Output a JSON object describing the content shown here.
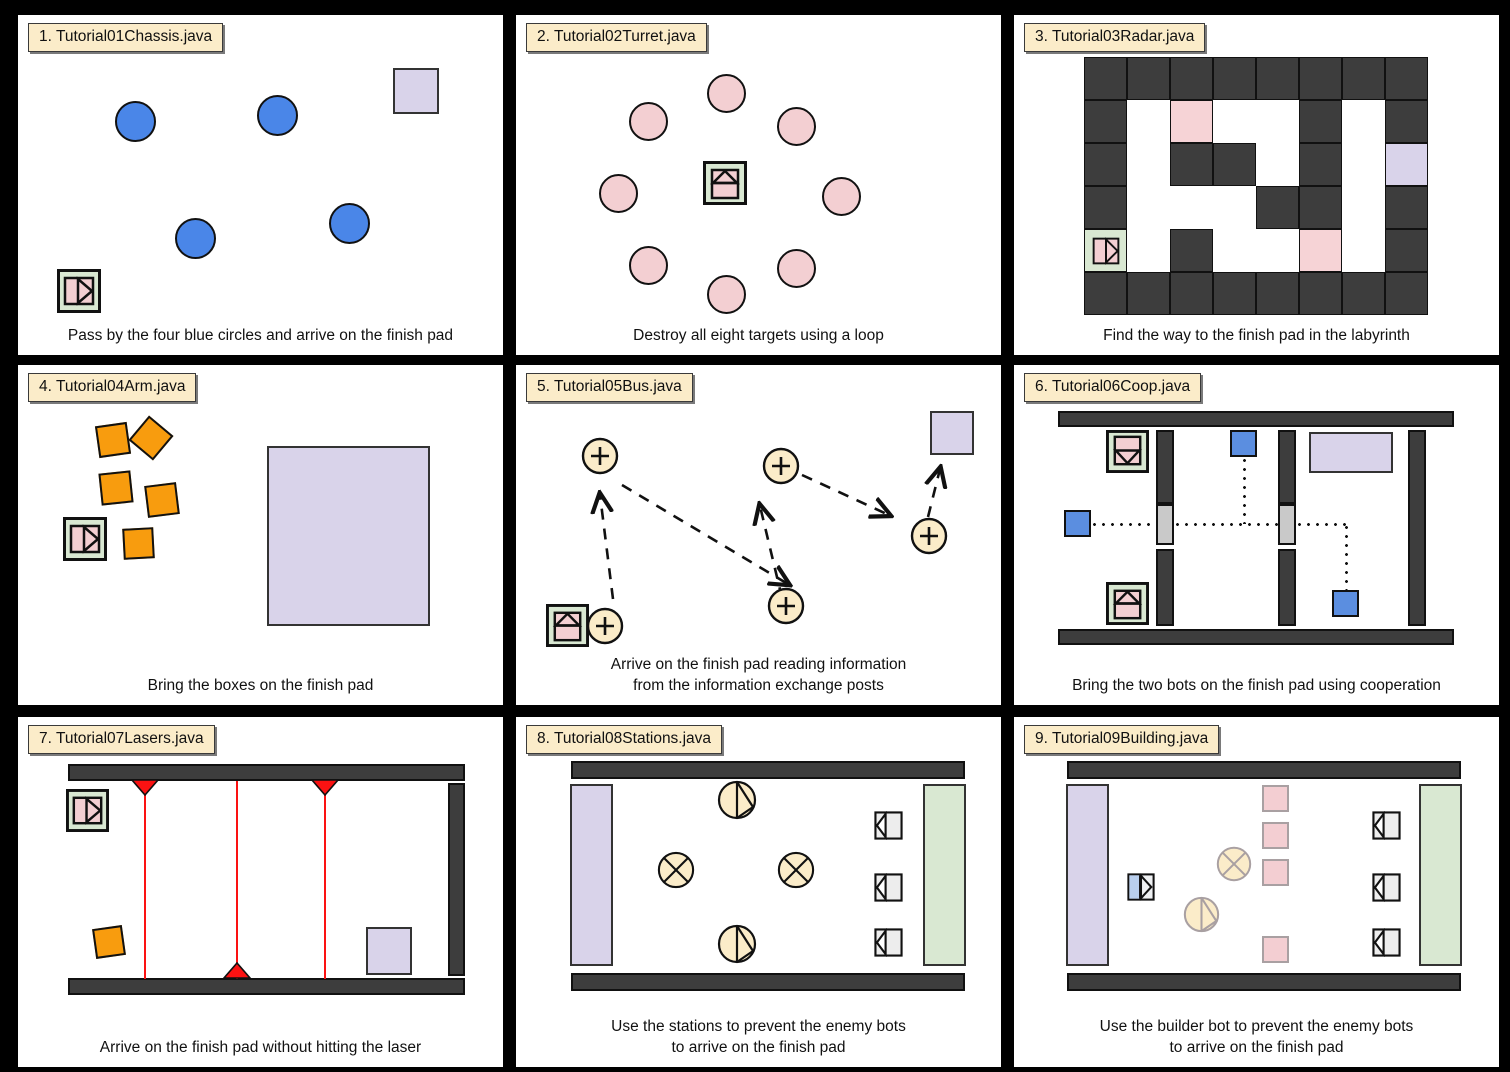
{
  "meta": {
    "background_color": "#000000",
    "panel_background": "#ffffff",
    "title_background": "#fbecc9",
    "accent_blue": "#4a86e8",
    "accent_pink": "#f3cfd2",
    "accent_purple": "#d9d3ea",
    "accent_green": "#d9e8d2",
    "accent_orange": "#f89c0e",
    "wall_gray": "#3d3d3d",
    "laser_red": "#fb1212",
    "post_cream": "#fbecc9"
  },
  "panels": [
    {
      "index": "1.",
      "title": "1. Tutorial01Chassis.java",
      "caption": "Pass by the four blue circles and arrive on the finish pad",
      "icons": {
        "bot": "bot-chassis-icon",
        "target": "blue-circle-icon",
        "finish": "finish-pad-icon"
      },
      "counts": {
        "blue_circles": 4
      }
    },
    {
      "index": "2.",
      "title": "2. Tutorial02Turret.java",
      "caption": "Destroy all eight targets using a loop",
      "icons": {
        "bot": "bot-turret-icon",
        "target": "pink-target-icon"
      },
      "counts": {
        "targets": 8
      }
    },
    {
      "index": "3.",
      "title": "3. Tutorial03Radar.java",
      "caption": "Find the way to the finish pad in the labyrinth",
      "icons": {
        "bot": "bot-chassis-icon",
        "finish": "finish-pad-icon",
        "wall": "wall-cell-icon"
      },
      "maze": {
        "cols": 8,
        "rows": 6,
        "legend": {
          "W": "wall",
          "O": "open",
          "P": "pink-pad",
          "F": "finish-pad",
          "B": "bot-start"
        },
        "cells": [
          [
            "W",
            "W",
            "W",
            "W",
            "W",
            "W",
            "W",
            "W"
          ],
          [
            "W",
            "O",
            "P",
            "O",
            "O",
            "W",
            "O",
            "W"
          ],
          [
            "W",
            "O",
            "W",
            "W",
            "O",
            "W",
            "O",
            "F"
          ],
          [
            "W",
            "O",
            "O",
            "O",
            "W",
            "W",
            "O",
            "W"
          ],
          [
            "B",
            "O",
            "W",
            "O",
            "O",
            "P",
            "O",
            "W"
          ],
          [
            "W",
            "W",
            "W",
            "W",
            "W",
            "W",
            "W",
            "W"
          ]
        ]
      }
    },
    {
      "index": "4.",
      "title": "4. Tutorial04Arm.java",
      "caption": "Bring the boxes on the finish pad",
      "icons": {
        "bot": "bot-chassis-icon",
        "box": "orange-box-icon",
        "finish": "finish-pad-icon"
      },
      "counts": {
        "boxes": 5
      }
    },
    {
      "index": "5.",
      "title": "5. Tutorial05Bus.java",
      "caption_line1": "Arrive on the finish pad reading information",
      "caption_line2": "from the information exchange posts",
      "icons": {
        "bot": "bot-turret-icon",
        "post": "info-post-icon",
        "finish": "finish-pad-icon",
        "arrow": "dashed-arrow-icon"
      },
      "counts": {
        "posts": 5,
        "arrows": 5
      },
      "post_symbol": "+"
    },
    {
      "index": "6.",
      "title": "6. Tutorial06Coop.java",
      "caption": "Bring the two bots on the finish pad using cooperation",
      "icons": {
        "bot_a": "bot-down-icon",
        "bot_b": "bot-up-icon",
        "switch": "blue-switch-icon",
        "door": "sliding-door-icon",
        "wall": "wall-icon",
        "finish": "finish-pad-icon"
      },
      "counts": {
        "bots": 2,
        "switches": 3,
        "doors": 2
      }
    },
    {
      "index": "7.",
      "title": "7. Tutorial07Lasers.java",
      "caption": "Arrive on the finish pad without hitting the laser",
      "icons": {
        "bot": "bot-chassis-icon",
        "laser_emitter": "laser-emitter-icon",
        "box": "orange-box-icon",
        "finish": "finish-pad-icon",
        "wall": "wall-icon"
      },
      "counts": {
        "lasers": 3
      }
    },
    {
      "index": "8.",
      "title": "8. Tutorial08Stations.java",
      "caption_line1": "Use the stations to prevent the enemy bots",
      "caption_line2": "to arrive on the finish pad",
      "icons": {
        "station_half": "station-half-icon",
        "station_cross": "station-cross-icon",
        "enemy": "enemy-bot-icon",
        "start_pad": "start-pad-icon",
        "finish_pad": "finish-pad-icon",
        "wall": "wall-icon"
      },
      "counts": {
        "stations": 4,
        "enemies": 3
      }
    },
    {
      "index": "9.",
      "title": "9. Tutorial09Building.java",
      "caption_line1": "Use the builder bot to prevent the enemy bots",
      "caption_line2": "to arrive on the finish pad",
      "icons": {
        "bot": "builder-bot-icon",
        "station_half": "station-half-icon",
        "station_cross": "station-cross-icon",
        "block": "pink-block-icon",
        "enemy": "enemy-bot-icon",
        "start_pad": "start-pad-icon",
        "finish_pad": "finish-pad-icon",
        "wall": "wall-icon"
      },
      "counts": {
        "blocks": 4,
        "enemies": 3,
        "stations": 2
      }
    }
  ]
}
